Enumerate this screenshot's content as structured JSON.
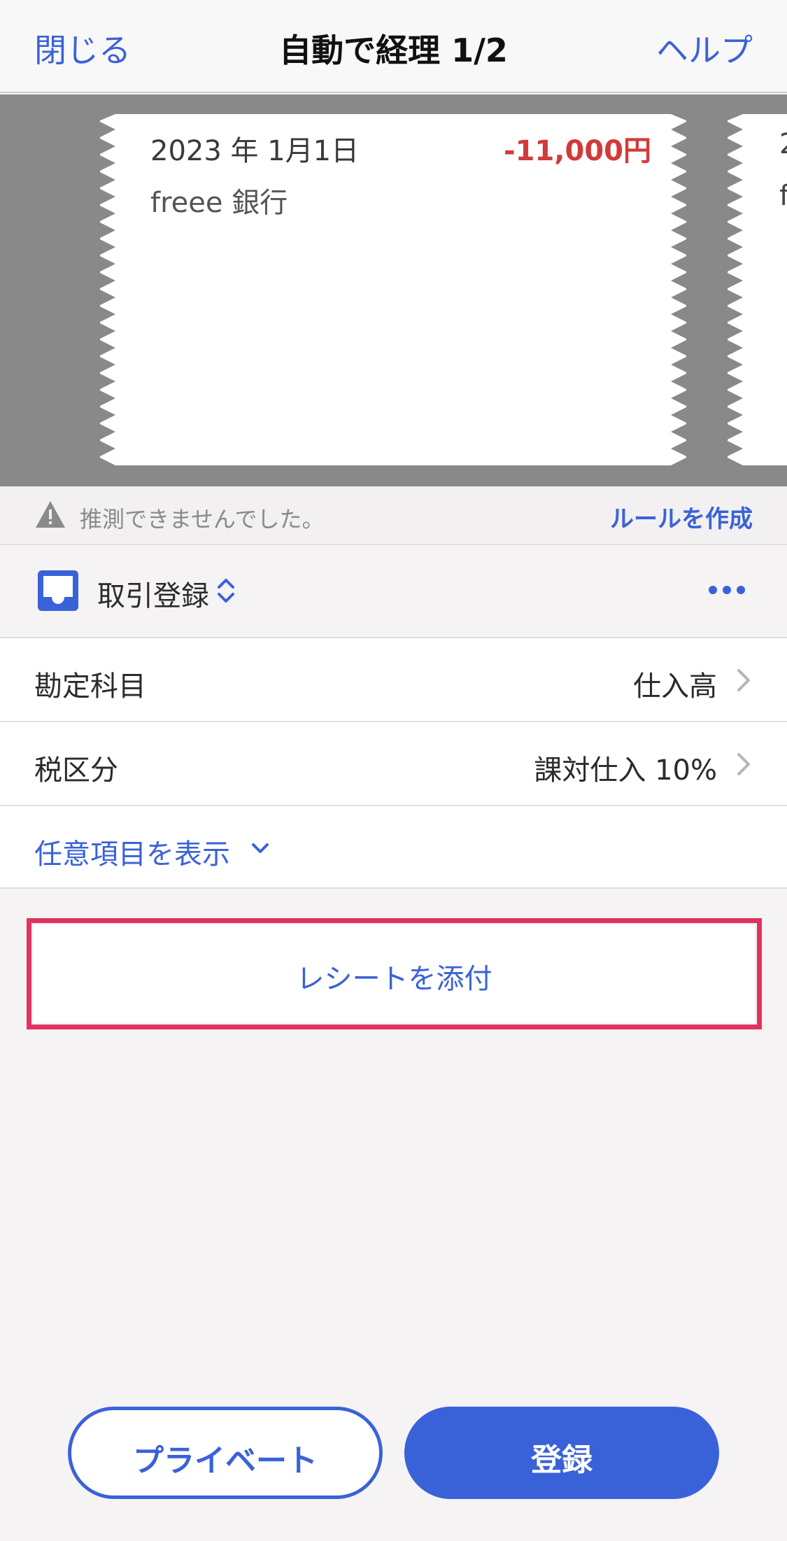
{
  "nav": {
    "close_label": "閉じる",
    "title": "自動で経理 1/2",
    "help_label": "ヘルプ"
  },
  "receipt": {
    "date": "2023 年 1月1日",
    "amount": "-11,000円",
    "bank": "freee 銀行",
    "next_peek_line1": "2",
    "next_peek_line2": "f"
  },
  "warning": {
    "icon": "warning-triangle-icon",
    "text": "推測できませんでした。",
    "link": "ルールを作成"
  },
  "transaction_type": {
    "icon": "inbox-icon",
    "label": "取引登録",
    "toggle_icon": "chevron-up-down-icon",
    "more_icon": "ellipsis-icon"
  },
  "form": {
    "account_label": "勘定科目",
    "account_value": "仕入高",
    "tax_label": "税区分",
    "tax_value": "課対仕入 10%",
    "optional_link": "任意項目を表示"
  },
  "attach": {
    "label": "レシートを添付"
  },
  "buttons": {
    "private_label": "プライベート",
    "register_label": "登録"
  },
  "colors": {
    "accent": "#3a62d8",
    "amount_negative": "#d23a3a",
    "highlight": "#e0335f"
  }
}
